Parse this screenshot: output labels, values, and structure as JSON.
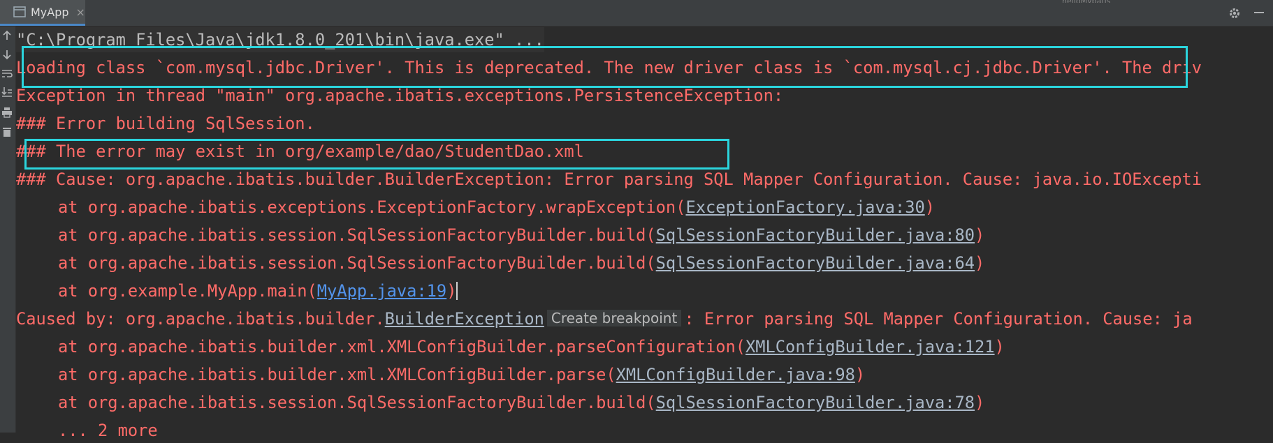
{
  "tab": {
    "title": "MyApp",
    "close": "×"
  },
  "topstrip": "helloMybatis",
  "toolbar": {
    "settings_icon": "gear-icon",
    "hide_icon": "minus-icon"
  },
  "gutter": [
    "arrow-up-icon",
    "arrow-down-icon",
    "soft-wrap-icon",
    "scroll-end-icon",
    "print-icon",
    "trash-icon"
  ],
  "console": {
    "command": "\"C:\\Program Files\\Java\\jdk1.8.0_201\\bin\\java.exe\" ...",
    "l1": "Loading class `com.mysql.jdbc.Driver'. This is deprecated. The new driver class is `com.mysql.cj.jdbc.Driver'. The driv",
    "l2": "Exception in thread \"main\" org.apache.ibatis.exceptions.PersistenceException:",
    "l3": "### Error building SqlSession.",
    "l4": "### The error may exist in org/example/dao/StudentDao.xml",
    "l5": "### Cause: org.apache.ibatis.builder.BuilderException: Error parsing SQL Mapper Configuration. Cause: java.io.IOExcepti",
    "s1": {
      "pre": "at org.apache.ibatis.exceptions.ExceptionFactory.wrapException(",
      "link": "ExceptionFactory.java:30",
      "post": ")"
    },
    "s2": {
      "pre": "at org.apache.ibatis.session.SqlSessionFactoryBuilder.build(",
      "link": "SqlSessionFactoryBuilder.java:80",
      "post": ")"
    },
    "s3": {
      "pre": "at org.apache.ibatis.session.SqlSessionFactoryBuilder.build(",
      "link": "SqlSessionFactoryBuilder.java:64",
      "post": ")"
    },
    "s4": {
      "pre": "at org.example.MyApp.main(",
      "link": "MyApp.java:19",
      "post": ")"
    },
    "cb": {
      "pre": "Caused by: org.apache.ibatis.builder.",
      "link": "BuilderException",
      "bp": "Create breakpoint",
      "post": ": Error parsing SQL Mapper Configuration. Cause: ja"
    },
    "s5": {
      "pre": "at org.apache.ibatis.builder.xml.XMLConfigBuilder.parseConfiguration(",
      "link": "XMLConfigBuilder.java:121",
      "post": ")"
    },
    "s6": {
      "pre": "at org.apache.ibatis.builder.xml.XMLConfigBuilder.parse(",
      "link": "XMLConfigBuilder.java:98",
      "post": ")"
    },
    "s7": {
      "pre": "at org.apache.ibatis.session.SqlSessionFactoryBuilder.build(",
      "link": "SqlSessionFactoryBuilder.java:78",
      "post": ")"
    },
    "more": "... 2 more"
  },
  "colors": {
    "error": "#ff6b68",
    "highlight": "#2bd5dd",
    "link": "#a9b7c6",
    "link_active": "#5394ec"
  }
}
